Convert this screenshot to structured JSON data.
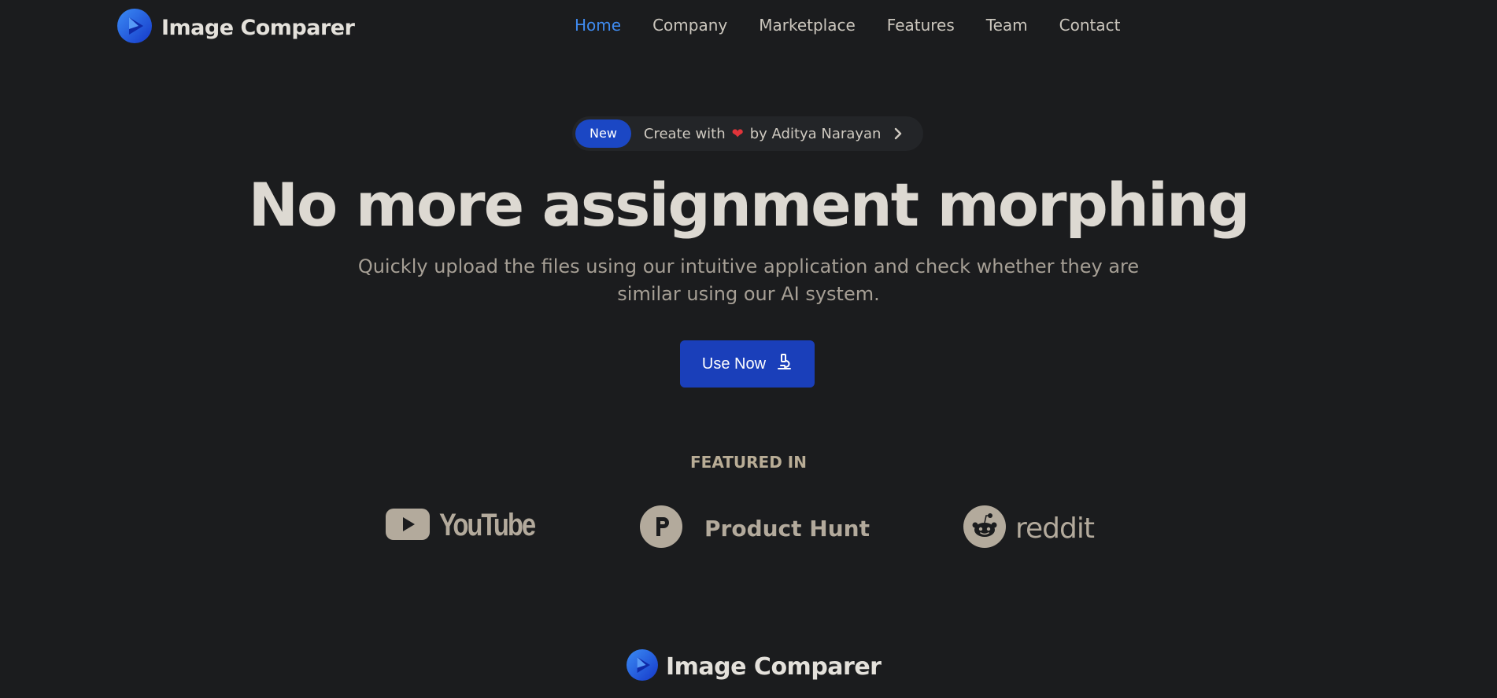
{
  "header": {
    "brand_name": "Image Comparer",
    "nav": [
      {
        "label": "Home",
        "active": true
      },
      {
        "label": "Company",
        "active": false
      },
      {
        "label": "Marketplace",
        "active": false
      },
      {
        "label": "Features",
        "active": false
      },
      {
        "label": "Team",
        "active": false
      },
      {
        "label": "Contact",
        "active": false
      }
    ]
  },
  "announcement": {
    "badge": "New",
    "text_before": "Create with",
    "icon": "heart-icon",
    "text_after": "by Aditya Narayan"
  },
  "hero": {
    "title": "No more assignment morphing",
    "subtitle": "Quickly upload the files using our intuitive application and check whether they are similar using our AI system.",
    "cta_label": "Use Now",
    "cta_icon": "microscope-icon"
  },
  "featured": {
    "label": "FEATURED IN",
    "logos": [
      "YouTube",
      "Product Hunt",
      "reddit"
    ]
  },
  "footer": {
    "brand_name": "Image Comparer"
  },
  "colors": {
    "background": "#1b1c1e",
    "accent": "#1a3fba",
    "nav_active": "#3f8bf0",
    "logo_grey": "#b3aa9c"
  }
}
